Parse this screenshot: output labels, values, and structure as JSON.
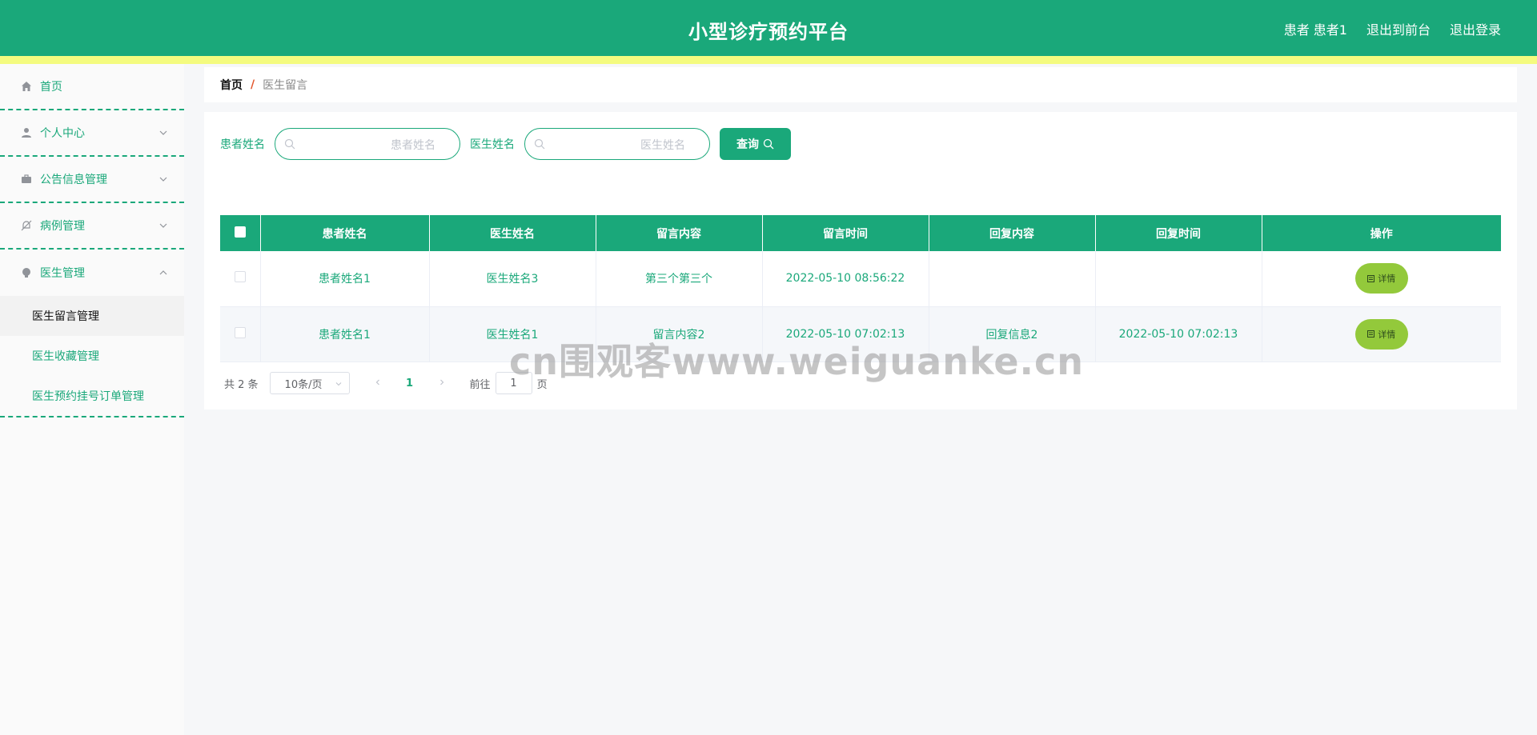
{
  "header": {
    "title": "小型诊疗预约平台",
    "user": "患者 患者1",
    "to_front": "退出到前台",
    "logout": "退出登录"
  },
  "sidebar": {
    "items": [
      {
        "label": "首页",
        "icon": "home-icon"
      },
      {
        "label": "个人中心",
        "icon": "user-icon"
      },
      {
        "label": "公告信息管理",
        "icon": "briefcase-icon"
      },
      {
        "label": "病例管理",
        "icon": "bell-off-icon"
      },
      {
        "label": "医生管理",
        "icon": "bulb-icon"
      }
    ],
    "subitems": [
      {
        "label": "医生留言管理",
        "active": true
      },
      {
        "label": "医生收藏管理",
        "active": false
      },
      {
        "label": "医生预约挂号订单管理",
        "active": false
      }
    ]
  },
  "breadcrumb": {
    "home": "首页",
    "separator": "/",
    "current": "医生留言"
  },
  "search": {
    "patient_label": "患者姓名",
    "patient_placeholder": "患者姓名",
    "doctor_label": "医生姓名",
    "doctor_placeholder": "医生姓名",
    "query_button": "查询"
  },
  "table": {
    "columns": [
      "患者姓名",
      "医生姓名",
      "留言内容",
      "留言时间",
      "回复内容",
      "回复时间",
      "操作"
    ],
    "rows": [
      {
        "patient": "患者姓名1",
        "doctor": "医生姓名3",
        "content": "第三个第三个",
        "time": "2022-05-10 08:56:22",
        "reply": "",
        "reply_time": "",
        "action": "详情"
      },
      {
        "patient": "患者姓名1",
        "doctor": "医生姓名1",
        "content": "留言内容2",
        "time": "2022-05-10 07:02:13",
        "reply": "回复信息2",
        "reply_time": "2022-05-10 07:02:13",
        "action": "详情"
      }
    ]
  },
  "pagination": {
    "total": "共 2 条",
    "page_size": "10条/页",
    "current_page": "1",
    "goto_label": "前往",
    "goto_value": "1",
    "page_suffix": "页"
  },
  "watermark": "cn围观客www.weiguanke.cn",
  "colors": {
    "primary": "#1aa87a",
    "stripe": "#f4fb7f",
    "detail_button": "#93c93b",
    "breadcrumb_separator": "#e2572e"
  }
}
